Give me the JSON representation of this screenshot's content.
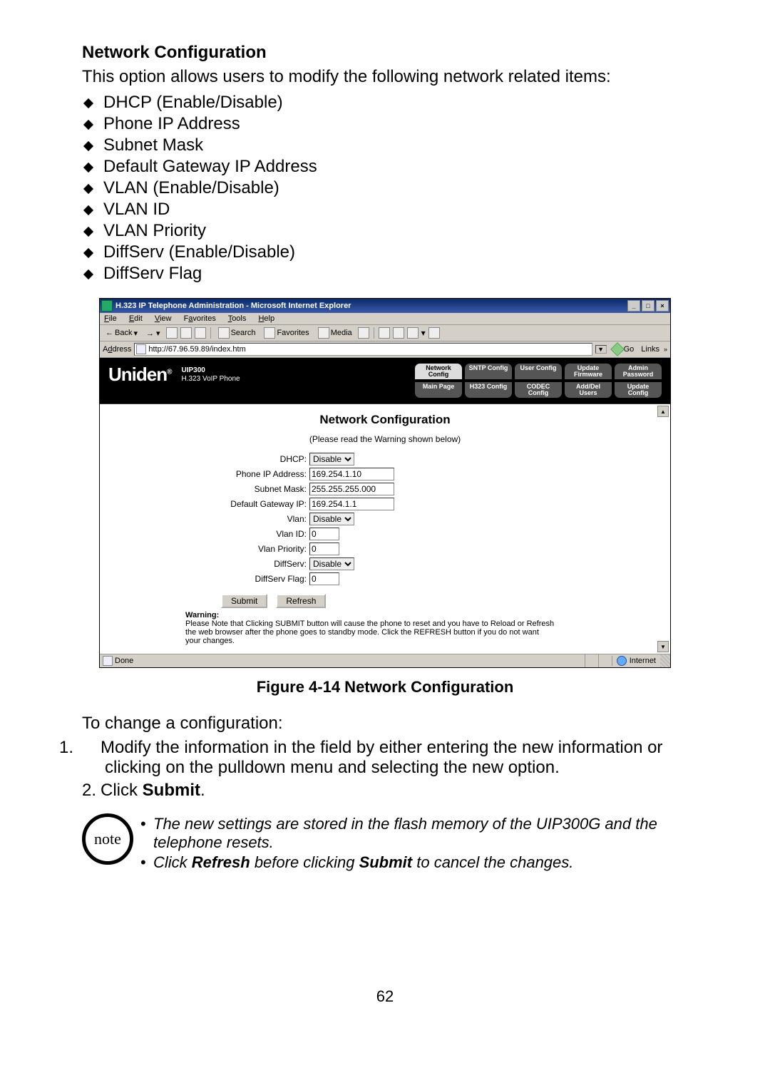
{
  "heading": "Network Configuration",
  "intro": "This option allows users to modify the following network related items:",
  "bullets": [
    "DHCP (Enable/Disable)",
    "Phone IP Address",
    "Subnet Mask",
    "Default Gateway IP Address",
    "VLAN (Enable/Disable)",
    "VLAN ID",
    "VLAN Priority",
    "DiffServ (Enable/Disable)",
    "DiffServ Flag"
  ],
  "ie": {
    "title": "H.323 IP Telephone Administration - Microsoft Internet Explorer",
    "menu": {
      "file": "File",
      "edit": "Edit",
      "view": "View",
      "favorites": "Favorites",
      "tools": "Tools",
      "help": "Help"
    },
    "toolbar": {
      "back": "Back",
      "search": "Search",
      "favorites": "Favorites",
      "media": "Media"
    },
    "address_label": "Address",
    "url": "http://67.96.59.89/index.htm",
    "go": "Go",
    "links": "Links",
    "brand": "Uniden",
    "model": "UIP300",
    "product": "H.323 VoIP Phone",
    "tabs_top": [
      "Network Config",
      "SNTP Config",
      "User Config",
      "Update Firmware",
      "Admin Password"
    ],
    "tabs_bottom": [
      "Main Page",
      "H323 Config",
      "CODEC Config",
      "Add/Del Users",
      "Update Config"
    ],
    "cfg_title": "Network Configuration",
    "cfg_sub": "(Please read the Warning shown below)",
    "fields": {
      "dhcp_label": "DHCP:",
      "dhcp_value": "Disable",
      "phoneip_label": "Phone IP Address:",
      "phoneip_value": "169.254.1.10",
      "subnet_label": "Subnet Mask:",
      "subnet_value": "255.255.255.000",
      "gateway_label": "Default Gateway IP:",
      "gateway_value": "169.254.1.1",
      "vlan_label": "Vlan:",
      "vlan_value": "Disable",
      "vlanid_label": "Vlan ID:",
      "vlanid_value": "0",
      "vlanprio_label": "Vlan Priority:",
      "vlanprio_value": "0",
      "diffserv_label": "DiffServ:",
      "diffserv_value": "Disable",
      "diffflag_label": "DiffServ Flag:",
      "diffflag_value": "0"
    },
    "submit": "Submit",
    "refresh": "Refresh",
    "warning_title": "Warning:",
    "warning_text": "Please Note that Clicking SUBMIT button will cause the phone to reset and you have to Reload or Refresh the web browser after the phone goes to standby mode. Click the REFRESH button if you do not want your changes.",
    "status_done": "Done",
    "status_zone": "Internet"
  },
  "figcaption": "Figure 4-14 Network Configuration",
  "para_after": "To change a configuration:",
  "steps": [
    {
      "num": "1.",
      "text": "Modify the information in the field by either entering the new information or clicking on the pulldown menu and selecting the new option."
    },
    {
      "num": "2.",
      "text_pre": "Click ",
      "text_bold": "Submit",
      "text_post": "."
    }
  ],
  "note_label": "note",
  "notes": [
    {
      "pre": "The new settings are stored in the flash memory of the UIP300G and the telephone resets."
    },
    {
      "pre": "Click ",
      "b1": "Refresh",
      "mid": " before clicking ",
      "b2": "Submit",
      "post": " to cancel the changes."
    }
  ],
  "page_number": "62"
}
